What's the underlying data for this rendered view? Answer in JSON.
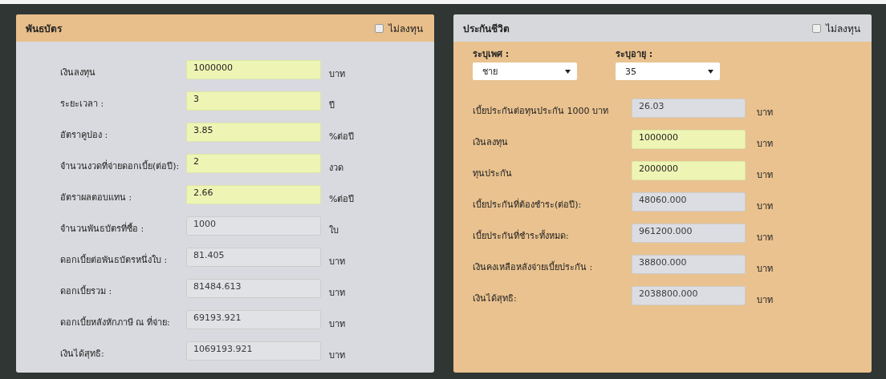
{
  "panels": [
    {
      "title": "พันธบัตร",
      "kind": "orange_header",
      "checkbox": {
        "label": "ไม่ลงทุน",
        "checked": false
      },
      "rows": [
        {
          "label": "เงินลงทุน",
          "value": "1000000",
          "unit": "บาท",
          "kind": "input"
        },
        {
          "label": "ระยะเวลา :",
          "value": "3",
          "unit": "ปี",
          "kind": "input"
        },
        {
          "label": "อัตราคูปอง :",
          "value": "3.85",
          "unit": "%ต่อปี",
          "kind": "input"
        },
        {
          "label": "จำนวนงวดที่จ่ายดอกเบี้ย(ต่อปี):",
          "value": "2",
          "unit": "งวด",
          "kind": "input"
        },
        {
          "label": "อัตราผลตอบแทน :",
          "value": "2.66",
          "unit": "%ต่อปี",
          "kind": "input"
        },
        {
          "label": "จำนวนพันธบัตรที่ซื้อ :",
          "value": "1000",
          "unit": "ใบ",
          "kind": "output"
        },
        {
          "label": "ดอกเบี้ยต่อพันธบัตรหนึ่งใบ :",
          "value": "81.405",
          "unit": "บาท",
          "kind": "output"
        },
        {
          "label": "ดอกเบี้ยรวม :",
          "value": "81484.613",
          "unit": "บาท",
          "kind": "output"
        },
        {
          "label": "ดอกเบี้ยหลังหักภาษี ณ ที่จ่าย:",
          "value": "69193.921",
          "unit": "บาท",
          "kind": "output"
        },
        {
          "label": "เงินได้สุทธิ:",
          "value": "1069193.921",
          "unit": "บาท",
          "kind": "output"
        }
      ]
    },
    {
      "title": "ประกันชีวิต",
      "kind": "grey_header",
      "checkbox": {
        "label": "ไม่ลงทุน",
        "checked": false
      },
      "selects": [
        {
          "label": "ระบุเพศ :",
          "value": "ชาย"
        },
        {
          "label": "ระบุอายุ :",
          "value": "35"
        }
      ],
      "rows": [
        {
          "label": "เบี้ยประกันต่อทุนประกัน 1000 บาท",
          "value": "26.03",
          "unit": "บาท",
          "kind": "output"
        },
        {
          "label": "เงินลงทุน",
          "value": "1000000",
          "unit": "บาท",
          "kind": "input"
        },
        {
          "label": "ทุนประกัน",
          "value": "2000000",
          "unit": "บาท",
          "kind": "input"
        },
        {
          "label": "เบี้ยประกันที่ต้องชำระ(ต่อปี):",
          "value": "48060.000",
          "unit": "บาท",
          "kind": "output"
        },
        {
          "label": "เบี้ยประกันที่ชำระทั้งหมด:",
          "value": "961200.000",
          "unit": "บาท",
          "kind": "output"
        },
        {
          "label": "เงินคงเหลือหลังจ่ายเบี้ยประกัน :",
          "value": "38800.000",
          "unit": "บาท",
          "kind": "output"
        },
        {
          "label": "เงินได้สุทธิ:",
          "value": "2038800.000",
          "unit": "บาท",
          "kind": "output"
        }
      ]
    }
  ]
}
